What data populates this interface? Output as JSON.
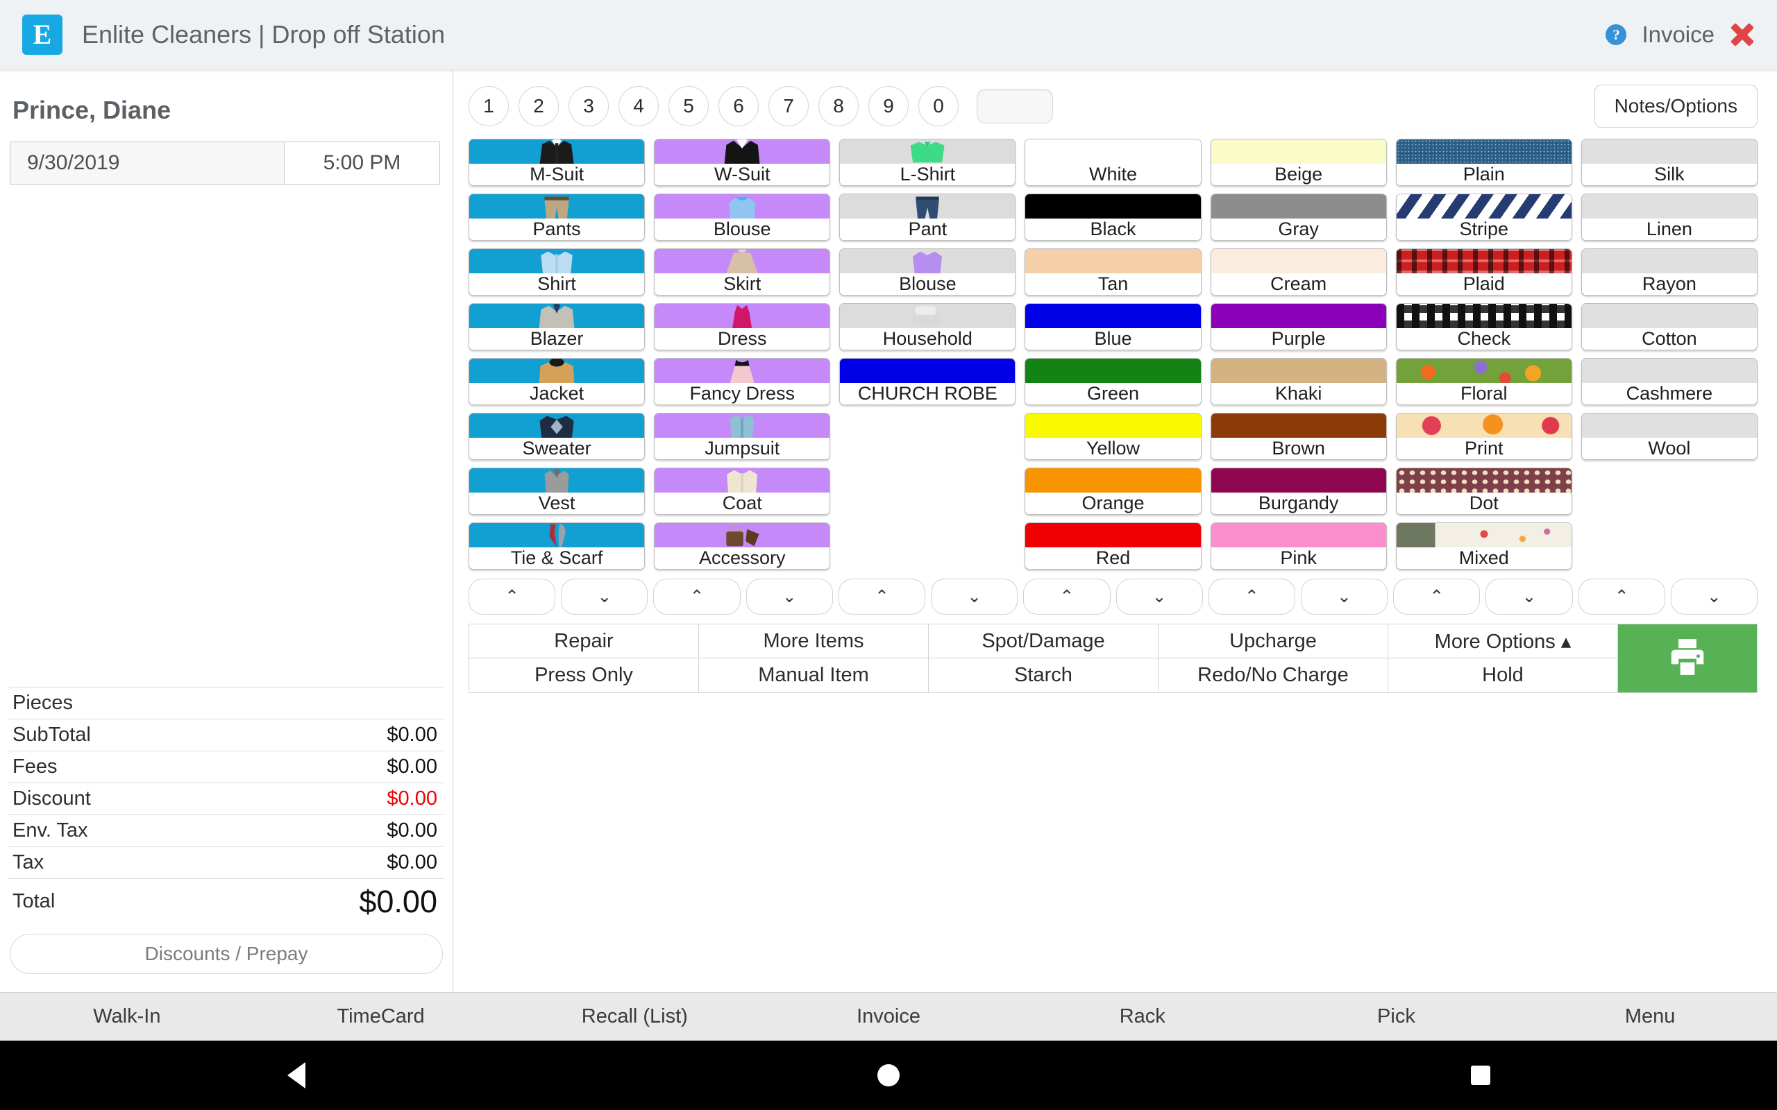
{
  "header": {
    "logo_letter": "E",
    "title": "Enlite Cleaners | Drop off Station",
    "help_icon": "question-mark-icon",
    "invoice_label": "Invoice",
    "close_icon": "close-x-icon"
  },
  "sidebar": {
    "customer_name": "Prince, Diane",
    "date": "9/30/2019",
    "time": "5:00 PM",
    "totals": [
      {
        "label": "Pieces",
        "value": ""
      },
      {
        "label": "SubTotal",
        "value": "$0.00"
      },
      {
        "label": "Fees",
        "value": "$0.00"
      },
      {
        "label": "Discount",
        "value": "$0.00"
      },
      {
        "label": "Env. Tax",
        "value": "$0.00"
      },
      {
        "label": "Tax",
        "value": "$0.00"
      }
    ],
    "total_label": "Total",
    "total_value": "$0.00",
    "discount_button": "Discounts / Prepay",
    "discount_color": "#f10000"
  },
  "quantity": {
    "buttons": [
      "1",
      "2",
      "3",
      "4",
      "5",
      "6",
      "7",
      "8",
      "9",
      "0"
    ],
    "field_value": "",
    "notes_button": "Notes/Options"
  },
  "grid": {
    "columns": 7,
    "cells": [
      {
        "label": "M-Suit",
        "kind": "garment",
        "bg": "#129fd2",
        "art": "mens-suit"
      },
      {
        "label": "W-Suit",
        "kind": "garment",
        "bg": "#c589f9",
        "art": "womens-suit"
      },
      {
        "label": "L-Shirt",
        "kind": "garment",
        "bg": "#dcdcdc",
        "art": "polo-shirt"
      },
      {
        "label": "White",
        "kind": "color",
        "bg": "#ffffff"
      },
      {
        "label": "Beige",
        "kind": "color",
        "bg": "#fbfbc8"
      },
      {
        "label": "Plain",
        "kind": "pattern",
        "bg": "#2c5e86",
        "art": "denim"
      },
      {
        "label": "Silk",
        "kind": "fabric",
        "bg": "#e0e0e0"
      },
      {
        "label": "Pants",
        "kind": "garment",
        "bg": "#129fd2",
        "art": "pants"
      },
      {
        "label": "Blouse",
        "kind": "garment",
        "bg": "#c589f9",
        "art": "blouse-bow"
      },
      {
        "label": "Pant",
        "kind": "garment",
        "bg": "#dcdcdc",
        "art": "jeans"
      },
      {
        "label": "Black",
        "kind": "color",
        "bg": "#000000"
      },
      {
        "label": "Gray",
        "kind": "color",
        "bg": "#8d8d8d"
      },
      {
        "label": "Stripe",
        "kind": "pattern",
        "bg": "#ffffff",
        "art": "stripe"
      },
      {
        "label": "Linen",
        "kind": "fabric",
        "bg": "#e0e0e0"
      },
      {
        "label": "Shirt",
        "kind": "garment",
        "bg": "#129fd2",
        "art": "dress-shirt"
      },
      {
        "label": "Skirt",
        "kind": "garment",
        "bg": "#c589f9",
        "art": "skirt"
      },
      {
        "label": "Blouse",
        "kind": "garment",
        "bg": "#dcdcdc",
        "art": "purple-blouse"
      },
      {
        "label": "Tan",
        "kind": "color",
        "bg": "#f5cfa8"
      },
      {
        "label": "Cream",
        "kind": "color",
        "bg": "#fbeddd"
      },
      {
        "label": "Plaid",
        "kind": "pattern",
        "bg": "#cc1f1f",
        "art": "plaid"
      },
      {
        "label": "Rayon",
        "kind": "fabric",
        "bg": "#e0e0e0"
      },
      {
        "label": "Blazer",
        "kind": "garment",
        "bg": "#129fd2",
        "art": "blazer"
      },
      {
        "label": "Dress",
        "kind": "garment",
        "bg": "#c589f9",
        "art": "dress"
      },
      {
        "label": "Household",
        "kind": "garment",
        "bg": "#dcdcdc",
        "art": "linens"
      },
      {
        "label": "Blue",
        "kind": "color",
        "bg": "#0000e6"
      },
      {
        "label": "Purple",
        "kind": "color",
        "bg": "#8b00b8"
      },
      {
        "label": "Check",
        "kind": "pattern",
        "bg": "#ffffff",
        "art": "check"
      },
      {
        "label": "Cotton",
        "kind": "fabric",
        "bg": "#e0e0e0"
      },
      {
        "label": "Jacket",
        "kind": "garment",
        "bg": "#129fd2",
        "art": "jacket"
      },
      {
        "label": "Fancy Dress",
        "kind": "garment",
        "bg": "#c589f9",
        "art": "fancy-dress"
      },
      {
        "label": "CHURCH ROBE",
        "kind": "custom",
        "bg": "#0000e6"
      },
      {
        "label": "Green",
        "kind": "color",
        "bg": "#138313"
      },
      {
        "label": "Khaki",
        "kind": "color",
        "bg": "#d4b383"
      },
      {
        "label": "Floral",
        "kind": "pattern",
        "bg": "#76a832",
        "art": "floral"
      },
      {
        "label": "Cashmere",
        "kind": "fabric",
        "bg": "#e0e0e0"
      },
      {
        "label": "Sweater",
        "kind": "garment",
        "bg": "#129fd2",
        "art": "sweater"
      },
      {
        "label": "Jumpsuit",
        "kind": "garment",
        "bg": "#c589f9",
        "art": "jumpsuit"
      },
      {
        "label": "",
        "kind": "empty"
      },
      {
        "label": "Yellow",
        "kind": "color",
        "bg": "#f9f900"
      },
      {
        "label": "Brown",
        "kind": "color",
        "bg": "#8d3b06"
      },
      {
        "label": "Print",
        "kind": "pattern",
        "bg": "#f59a2e",
        "art": "print"
      },
      {
        "label": "Wool",
        "kind": "fabric",
        "bg": "#e0e0e0"
      },
      {
        "label": "Vest",
        "kind": "garment",
        "bg": "#129fd2",
        "art": "vest"
      },
      {
        "label": "Coat",
        "kind": "garment",
        "bg": "#c589f9",
        "art": "coat"
      },
      {
        "label": "",
        "kind": "empty"
      },
      {
        "label": "Orange",
        "kind": "color",
        "bg": "#f79400"
      },
      {
        "label": "Burgandy",
        "kind": "color",
        "bg": "#8e0750"
      },
      {
        "label": "Dot",
        "kind": "pattern",
        "bg": "#7d4048",
        "art": "dot"
      },
      {
        "label": "",
        "kind": "empty"
      },
      {
        "label": "Tie & Scarf",
        "kind": "garment",
        "bg": "#129fd2",
        "art": "tie-scarf"
      },
      {
        "label": "Accessory",
        "kind": "garment",
        "bg": "#c589f9",
        "art": "handbag"
      },
      {
        "label": "",
        "kind": "empty"
      },
      {
        "label": "Red",
        "kind": "color",
        "bg": "#f00000"
      },
      {
        "label": "Pink",
        "kind": "color",
        "bg": "#fb8fcd"
      },
      {
        "label": "Mixed",
        "kind": "pattern",
        "bg": "#ddd8c4",
        "art": "mixed"
      },
      {
        "label": "",
        "kind": "empty"
      }
    ]
  },
  "steppers": {
    "up_glyph": "⌃",
    "down_glyph": "⌄",
    "pair_count": 7
  },
  "actions": {
    "row1": [
      "Repair",
      "More Items",
      "Spot/Damage",
      "Upcharge",
      "More Options ▴"
    ],
    "row2": [
      "Press Only",
      "Manual Item",
      "Starch",
      "Redo/No Charge",
      "Hold"
    ],
    "print_icon": "printer-icon",
    "print_color": "#56b255"
  },
  "bottom_nav": [
    "Walk-In",
    "TimeCard",
    "Recall (List)",
    "Invoice",
    "Rack",
    "Pick",
    "Menu"
  ],
  "android_nav": [
    "back-triangle-icon",
    "home-circle-icon",
    "recents-square-icon"
  ]
}
